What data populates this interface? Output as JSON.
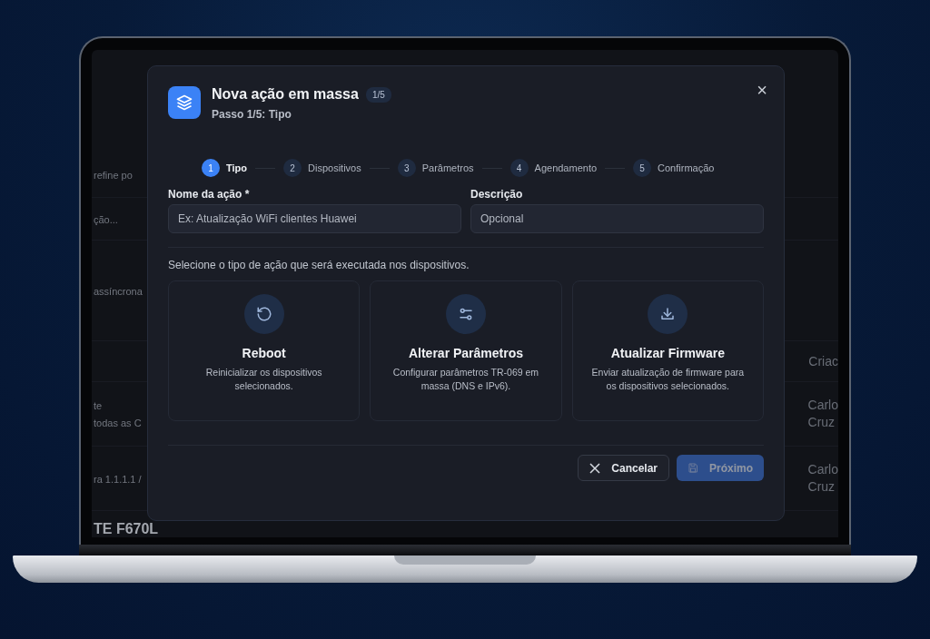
{
  "background_app": {
    "rows": [
      {
        "left": "refine po",
        "right": ""
      },
      {
        "left": "ção...",
        "right": ""
      },
      {
        "left": "assíncrona",
        "right": ""
      },
      {
        "left": "",
        "right": "Criac"
      },
      {
        "left": "te\ntodas as C",
        "right": "Carlo\nCruz"
      },
      {
        "left": "ra 1.1.1.1 /",
        "right": "Carlo\nCruz"
      },
      {
        "left": "TE F670L",
        "right": ""
      }
    ]
  },
  "dialog": {
    "title": "Nova ação em massa",
    "step_badge": "1/5",
    "subtitle": "Passo 1/5: Tipo",
    "close": "×",
    "steps": [
      {
        "number": "1",
        "label": "Tipo",
        "selected": true
      },
      {
        "number": "2",
        "label": "Dispositivos",
        "selected": false
      },
      {
        "number": "3",
        "label": "Parâmetros",
        "selected": false
      },
      {
        "number": "4",
        "label": "Agendamento",
        "selected": false
      },
      {
        "number": "5",
        "label": "Confirmação",
        "selected": false
      }
    ],
    "fields": [
      {
        "label": "Nome da ação *",
        "placeholder": "Ex: Atualização WiFi clientes Huawei"
      },
      {
        "label": "Descrição",
        "placeholder": "Opcional"
      }
    ],
    "instruction": "Selecione o tipo de ação que será executada nos dispositivos.",
    "action_types": [
      {
        "kind": "reboot",
        "title": "Reboot",
        "description": "Reinicializar os dispositivos selecionados.",
        "selected": false
      },
      {
        "kind": "parameters",
        "title": "Alterar Parâmetros",
        "description": "Configurar parâmetros TR-069 em massa (DNS e IPv6).",
        "selected": false
      },
      {
        "kind": "firmware",
        "title": "Atualizar Firmware",
        "description": "Enviar atualização de firmware para os dispositivos selecionados.",
        "selected": false
      }
    ],
    "buttons": [
      {
        "kind": "cancel",
        "label": "Cancelar",
        "disabled": false
      },
      {
        "kind": "next",
        "label": "Próximo",
        "disabled": true
      }
    ]
  }
}
